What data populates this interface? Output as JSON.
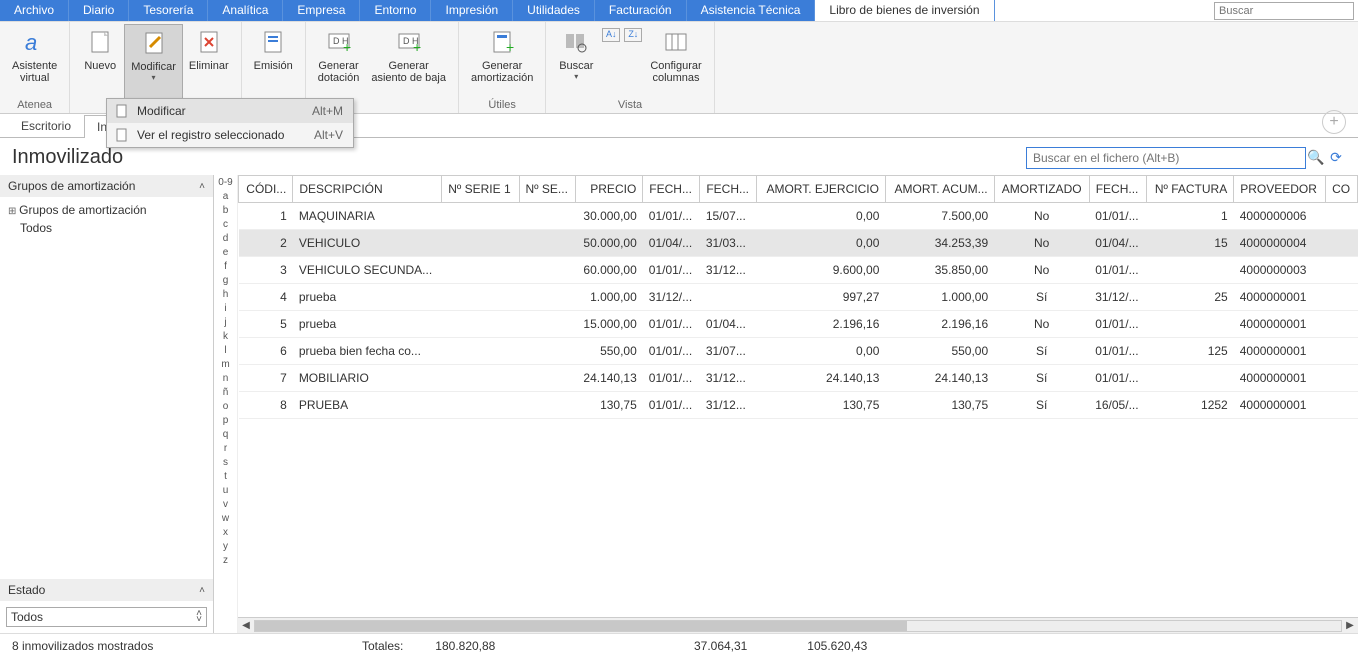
{
  "menubar": {
    "items": [
      "Archivo",
      "Diario",
      "Tesorería",
      "Analítica",
      "Empresa",
      "Entorno",
      "Impresión",
      "Utilidades",
      "Facturación",
      "Asistencia Técnica",
      "Libro de bienes de inversión"
    ],
    "active_index": 10,
    "search_placeholder": "Buscar"
  },
  "ribbon": {
    "groups": [
      {
        "label": "Atenea",
        "buttons": [
          {
            "name": "asistente-virtual",
            "line1": "Asistente",
            "line2": "virtual"
          }
        ]
      },
      {
        "label": "",
        "buttons": [
          {
            "name": "nuevo",
            "line1": "Nuevo",
            "line2": ""
          },
          {
            "name": "modificar",
            "line1": "Modificar",
            "line2": "",
            "has_chevron": true,
            "highlighted": true
          },
          {
            "name": "eliminar",
            "line1": "Eliminar",
            "line2": ""
          }
        ]
      },
      {
        "label": "",
        "buttons": [
          {
            "name": "emision",
            "line1": "Emisión",
            "line2": ""
          }
        ]
      },
      {
        "label": "",
        "buttons": [
          {
            "name": "generar-dotacion",
            "line1": "Generar",
            "line2": "dotación"
          },
          {
            "name": "generar-asiento-baja",
            "line1": "Generar",
            "line2": "asiento de baja"
          }
        ]
      },
      {
        "label": "Útiles",
        "buttons": [
          {
            "name": "generar-amortizacion",
            "line1": "Generar",
            "line2": "amortización"
          }
        ]
      },
      {
        "label": "Vista",
        "buttons": [
          {
            "name": "buscar",
            "line1": "Buscar",
            "line2": "",
            "has_chevron": true
          },
          {
            "name": "sort-asc",
            "mini": true
          },
          {
            "name": "sort-desc",
            "mini": true
          },
          {
            "name": "configurar-columnas",
            "line1": "Configurar",
            "line2": "columnas"
          }
        ]
      }
    ]
  },
  "dropdown": {
    "items": [
      {
        "label": "Modificar",
        "shortcut": "Alt+M",
        "hover": true
      },
      {
        "label": "Ver el registro seleccionado",
        "shortcut": "Alt+V"
      }
    ]
  },
  "tabs": {
    "items": [
      {
        "label": "Escritorio",
        "closable": false
      },
      {
        "label": "Inmovilizado",
        "closable": true,
        "active": true
      }
    ]
  },
  "page": {
    "title": "Inmovilizado",
    "search_placeholder": "Buscar en el fichero (Alt+B)"
  },
  "sidebar": {
    "section1_title": "Grupos de amortización",
    "tree_root": "Grupos de amortización",
    "tree_child": "Todos",
    "section2_title": "Estado",
    "state_value": "Todos"
  },
  "alpha": [
    "0-9",
    "a",
    "b",
    "c",
    "d",
    "e",
    "f",
    "g",
    "h",
    "i",
    "j",
    "k",
    "l",
    "m",
    "n",
    "ñ",
    "o",
    "p",
    "q",
    "r",
    "s",
    "t",
    "u",
    "v",
    "w",
    "x",
    "y",
    "z"
  ],
  "table": {
    "columns": [
      "CÓDI...",
      "DESCRIPCIÓN",
      "Nº SERIE 1",
      "Nº SE...",
      "PRECIO",
      "FECH...",
      "FECH...",
      "AMORT. EJERCICIO",
      "AMORT. ACUM...",
      "AMORTIZADO",
      "FECH...",
      "Nº FACTURA",
      "PROVEEDOR",
      "CO"
    ],
    "rows": [
      {
        "cod": "1",
        "desc": "MAQUINARIA",
        "s1": "",
        "s2": "",
        "precio": "30.000,00",
        "f1": "01/01/...",
        "f2": "15/07...",
        "aej": "0,00",
        "aac": "7.500,00",
        "amort": "No",
        "f3": "01/01/...",
        "nfac": "1",
        "prov": "4000000006",
        "co": ""
      },
      {
        "cod": "2",
        "desc": "VEHICULO",
        "s1": "",
        "s2": "",
        "precio": "50.000,00",
        "f1": "01/04/...",
        "f2": "31/03...",
        "aej": "0,00",
        "aac": "34.253,39",
        "amort": "No",
        "f3": "01/04/...",
        "nfac": "15",
        "prov": "4000000004",
        "co": "",
        "selected": true
      },
      {
        "cod": "3",
        "desc": "VEHICULO SECUNDA...",
        "s1": "",
        "s2": "",
        "precio": "60.000,00",
        "f1": "01/01/...",
        "f2": "31/12...",
        "aej": "9.600,00",
        "aac": "35.850,00",
        "amort": "No",
        "f3": "01/01/...",
        "nfac": "",
        "prov": "4000000003",
        "co": ""
      },
      {
        "cod": "4",
        "desc": "prueba",
        "s1": "",
        "s2": "",
        "precio": "1.000,00",
        "f1": "31/12/...",
        "f2": "",
        "aej": "997,27",
        "aac": "1.000,00",
        "amort": "Sí",
        "f3": "31/12/...",
        "nfac": "25",
        "prov": "4000000001",
        "co": ""
      },
      {
        "cod": "5",
        "desc": "prueba",
        "s1": "",
        "s2": "",
        "precio": "15.000,00",
        "f1": "01/01/...",
        "f2": "01/04...",
        "aej": "2.196,16",
        "aac": "2.196,16",
        "amort": "No",
        "f3": "01/01/...",
        "nfac": "",
        "prov": "4000000001",
        "co": ""
      },
      {
        "cod": "6",
        "desc": "prueba bien fecha co...",
        "s1": "",
        "s2": "",
        "precio": "550,00",
        "f1": "01/01/...",
        "f2": "31/07...",
        "aej": "0,00",
        "aac": "550,00",
        "amort": "Sí",
        "f3": "01/01/...",
        "nfac": "125",
        "prov": "4000000001",
        "co": ""
      },
      {
        "cod": "7",
        "desc": "MOBILIARIO",
        "s1": "",
        "s2": "",
        "precio": "24.140,13",
        "f1": "01/01/...",
        "f2": "31/12...",
        "aej": "24.140,13",
        "aac": "24.140,13",
        "amort": "Sí",
        "f3": "01/01/...",
        "nfac": "",
        "prov": "4000000001",
        "co": ""
      },
      {
        "cod": "8",
        "desc": "PRUEBA",
        "s1": "",
        "s2": "",
        "precio": "130,75",
        "f1": "01/01/...",
        "f2": "31/12...",
        "aej": "130,75",
        "aac": "130,75",
        "amort": "Sí",
        "f3": "16/05/...",
        "nfac": "1252",
        "prov": "4000000001",
        "co": ""
      }
    ]
  },
  "footer": {
    "count_text": "8 inmovilizados mostrados",
    "totals_label": "Totales:",
    "total_precio": "180.820,88",
    "total_aej": "37.064,31",
    "total_aac": "105.620,43"
  }
}
